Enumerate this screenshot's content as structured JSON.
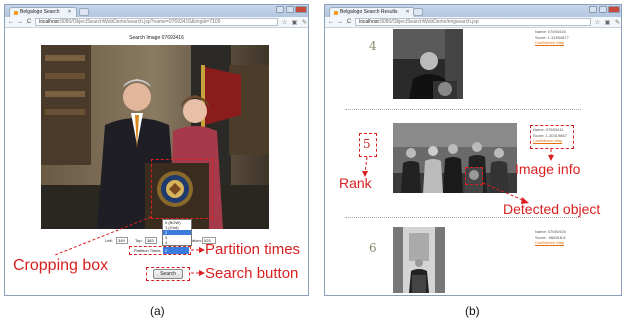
{
  "left": {
    "tab_title": "Belgalogo Search",
    "url_host": "localhost",
    "url_path": ":8080/ObjectSearchWebDemo/search.jsp?name=07693416&imgid=7109",
    "page_title": "Search Image 07693416",
    "inputs": {
      "left_label": "Left:",
      "left_value": "349",
      "top_label": "Top:",
      "top_value": "383",
      "right_label": "Right:",
      "right_value": "",
      "bottom_label": "Bottom:",
      "bottom_value": "525",
      "partition_label": "Partition Times",
      "partition_value": "2"
    },
    "dropdown_options": [
      "0 (BOW)",
      "1 (Grid)",
      "2",
      "3",
      "4"
    ],
    "dropdown_selected_index": 2,
    "search_button": "Search",
    "annotations": {
      "cropping_box": "Cropping box",
      "partition_times": "Partition times",
      "search_button": "Search button"
    },
    "caption": "(a)"
  },
  "right": {
    "tab_title": "Belgalogo Search Results",
    "url_host": "localhost",
    "url_path": ":8080/ObjectSearchWebDemo/imgsearch.jsp",
    "results": [
      {
        "rank": "4",
        "name": "Name: 07693416",
        "score": "Score: 1.31594877",
        "link": "Confidence Map"
      },
      {
        "rank": "5",
        "name": "Name: 07693411",
        "score": "Score: 1.30319867",
        "link": "Confidence Map"
      },
      {
        "rank": "6",
        "name": "Name: 07691928",
        "score": "Score: .966918.8",
        "link": "Confidence Map"
      }
    ],
    "annotations": {
      "rank": "Rank",
      "image_info": "Image info",
      "detected_object": "Detected object"
    },
    "caption": "(b)"
  },
  "colors": {
    "annotation": "#d92020",
    "link": "#e07010",
    "frame": "#8aa0b8"
  }
}
